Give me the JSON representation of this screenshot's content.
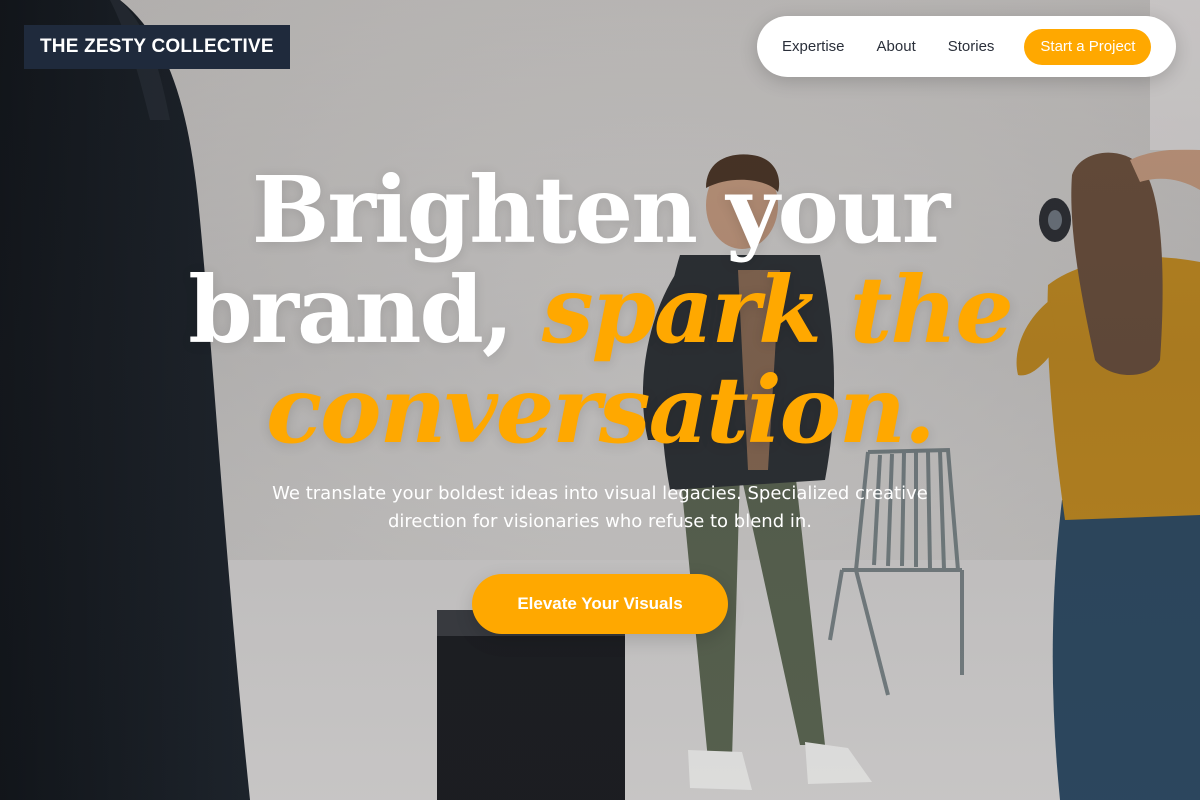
{
  "brand": {
    "logo_text": "THE ZESTY COLLECTIVE"
  },
  "nav": {
    "links": [
      "Expertise",
      "About",
      "Stories"
    ],
    "cta_label": "Start a Project"
  },
  "hero": {
    "headline_line1": "Brighten your",
    "headline_line2_plain": "brand,",
    "headline_accent_line2": "spark the",
    "headline_accent_line3": "conversation.",
    "subtitle": "We translate your boldest ideas into visual legacies. Specialized creative direction for visionaries who refuse to blend in.",
    "cta_label": "Elevate Your Visuals"
  },
  "colors": {
    "accent": "#ffa800",
    "logo_bg": "#1f2a3c",
    "nav_bg": "#ffffff",
    "headline": "#ffffff"
  }
}
